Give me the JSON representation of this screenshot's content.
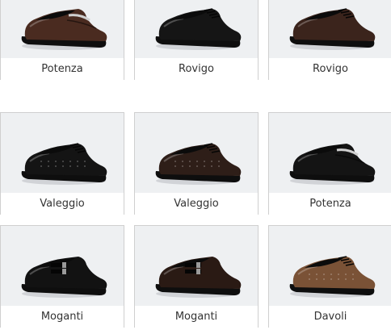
{
  "products": [
    {
      "name": "Potenza",
      "style": "loafer",
      "color": "#4a2b20"
    },
    {
      "name": "Rovigo",
      "style": "derby",
      "color": "#151515"
    },
    {
      "name": "Rovigo",
      "style": "derby",
      "color": "#3b241c"
    },
    {
      "name": "Valeggio",
      "style": "perforated",
      "color": "#141414"
    },
    {
      "name": "Valeggio",
      "style": "perforated",
      "color": "#2e1e18"
    },
    {
      "name": "Potenza",
      "style": "loafer",
      "color": "#141414"
    },
    {
      "name": "Moganti",
      "style": "monk",
      "color": "#121212"
    },
    {
      "name": "Moganti",
      "style": "monk",
      "color": "#2a1a14"
    },
    {
      "name": "Davoli",
      "style": "brogue",
      "color": "#7a5236"
    }
  ]
}
